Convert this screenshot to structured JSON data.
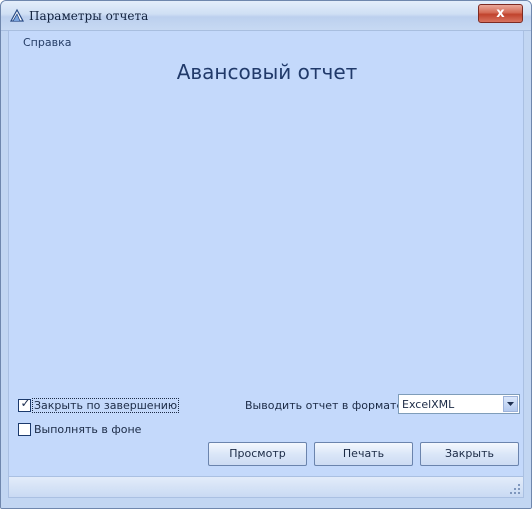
{
  "window": {
    "title": "Параметры отчета",
    "close_symbol": "x"
  },
  "menu": {
    "help": "Справка"
  },
  "report": {
    "title": "Авансовый отчет"
  },
  "options": {
    "close_on_finish": {
      "label": "Закрыть по завершению",
      "checked": true,
      "check_glyph": "✓"
    },
    "run_in_background": {
      "label": "Выполнять в фоне",
      "checked": false
    }
  },
  "format": {
    "label": "Выводить отчет в формате",
    "selected": "ExcelXML"
  },
  "buttons": {
    "preview": "Просмотр",
    "print": "Печать",
    "close": "Закрыть"
  },
  "colors": {
    "client_background": "#c4d9fb",
    "title_text": "#213a6a",
    "close_button": "#c0432d"
  }
}
